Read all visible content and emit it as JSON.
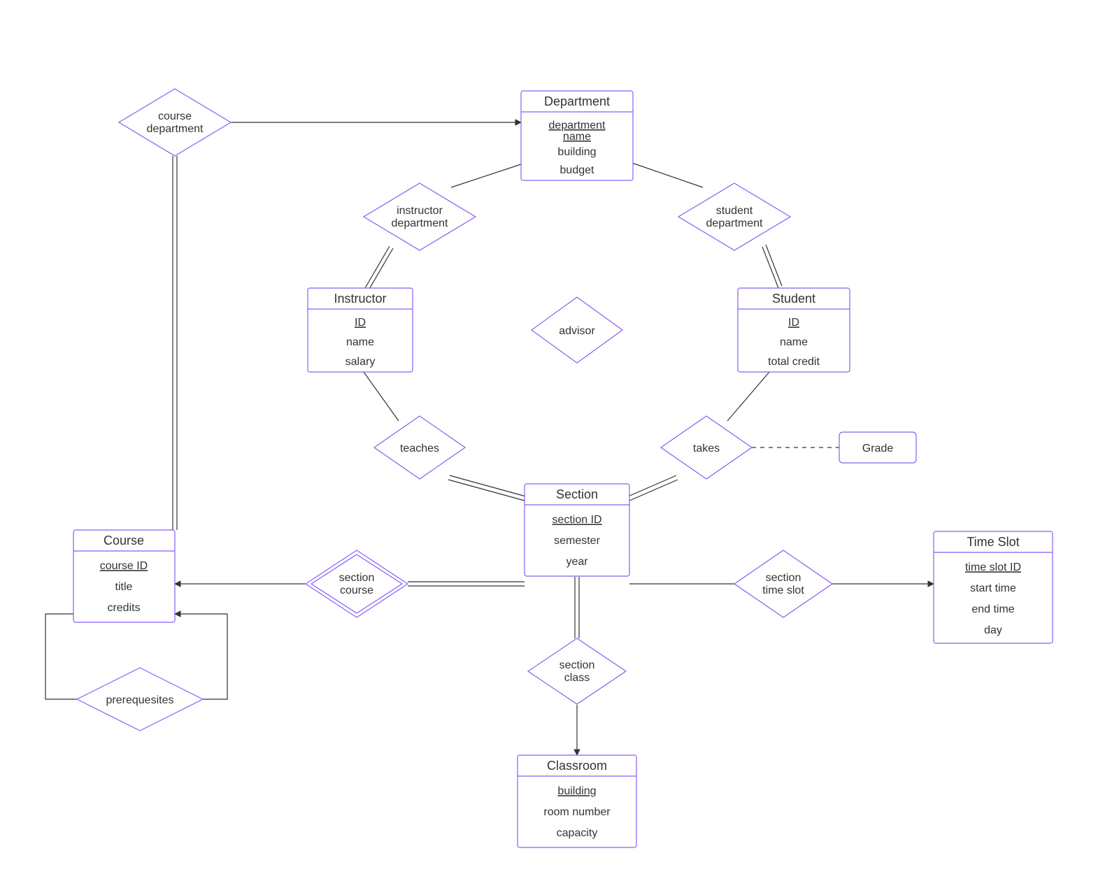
{
  "entities": {
    "department": {
      "title": "Department",
      "key": "department name",
      "attrs": [
        "building",
        "budget"
      ]
    },
    "instructor": {
      "title": "Instructor",
      "key": "ID",
      "attrs": [
        "name",
        "salary"
      ]
    },
    "student": {
      "title": "Student",
      "key": "ID",
      "attrs": [
        "name",
        "total credit"
      ]
    },
    "section": {
      "title": "Section",
      "key": "section ID",
      "attrs": [
        "semester",
        "year"
      ]
    },
    "course": {
      "title": "Course",
      "key": "course ID",
      "attrs": [
        "title",
        "credits"
      ]
    },
    "classroom": {
      "title": "Classroom",
      "key": "building",
      "attrs": [
        "room number",
        "capacity"
      ]
    },
    "timeslot": {
      "title": "Time Slot",
      "key": "time slot ID",
      "attrs": [
        "start time",
        "end time",
        "day"
      ]
    }
  },
  "relationships": {
    "course_department": {
      "line1": "course",
      "line2": "department"
    },
    "instructor_department": {
      "line1": "instructor",
      "line2": "department"
    },
    "student_department": {
      "line1": "student",
      "line2": "department"
    },
    "advisor": {
      "line1": "advisor",
      "line2": ""
    },
    "teaches": {
      "line1": "teaches",
      "line2": ""
    },
    "takes": {
      "line1": "takes",
      "line2": ""
    },
    "section_course": {
      "line1": "section",
      "line2": "course"
    },
    "section_timeslot": {
      "line1": "section",
      "line2": "time slot"
    },
    "section_class": {
      "line1": "section",
      "line2": "class"
    },
    "prerequisites": {
      "line1": "prerequesites",
      "line2": ""
    }
  },
  "assoc": {
    "grade": "Grade"
  }
}
